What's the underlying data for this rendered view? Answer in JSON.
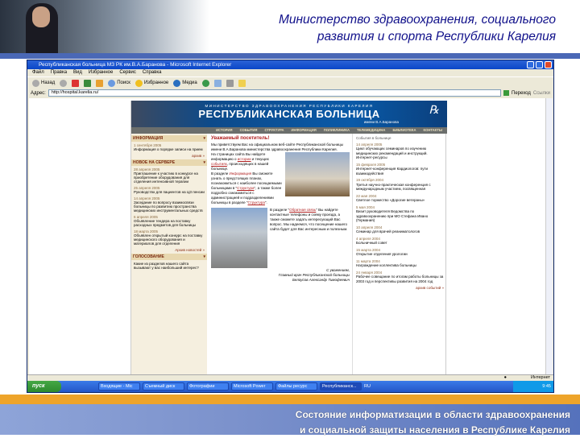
{
  "slide": {
    "title_line1": "Министерство здравоохранения, социального",
    "title_line2": "развития и спорта Республики Карелия",
    "subtitle_line1": "Состояние информатизации в области здравоохранения",
    "subtitle_line2": "и социальной защиты населения в Республике Карелия"
  },
  "browser": {
    "title": "Республиканская больница МЗ РК им.В.А.Баранова - Microsoft Internet Explorer",
    "menu": [
      "Файл",
      "Правка",
      "Вид",
      "Избранное",
      "Сервис",
      "Справка"
    ],
    "toolbar": {
      "back": "Назад",
      "search": "Поиск",
      "favorites": "Избранное",
      "media": "Медиа"
    },
    "address_label": "Адрес:",
    "address": "http://hospital.karelia.ru/",
    "go": "Переход",
    "links": "Ссылки",
    "status": "Интернет"
  },
  "taskbar": {
    "start": "пуск",
    "tasks": [
      "Входящие - Mic",
      "Съемный диск",
      "Фотографии",
      "Microsoft Power",
      "Файлы ресурс",
      "Республиканск..."
    ],
    "lang": "RU",
    "clock": "9:45"
  },
  "site": {
    "banner_ministry": "МИНИСТЕРСТВО ЗДРАВООХРАНЕНИЯ РЕСПУБЛИКИ КАРЕЛИЯ",
    "banner_name": "РЕСПУБЛИКАНСКАЯ БОЛЬНИЦА",
    "banner_sub": "имени В.А.Баранова",
    "logo": "РБ",
    "nav": [
      "ИСТОРИЯ",
      "СОБЫТИЯ",
      "СТРУКТУРА",
      "ИНФОРМАЦИЯ",
      "ПОЛИКЛИНИКА",
      "ТЕЛЕМЕДИЦИНА",
      "БИБЛИОТЕКА",
      "КОНТАКТЫ"
    ],
    "left": {
      "info_header": "ИНФОРМАЦИЯ",
      "info_items": [
        {
          "date": "1 сентября 2005",
          "text": "Информация о порядке записи на прием"
        }
      ],
      "info_archive": "архив »",
      "news_header": "НОВОЕ НА СЕРВЕРЕ",
      "news": [
        {
          "date": "28 апреля 2005",
          "text": "Приглашение к участию в конкурсе на приобретение оборудования для отделения интенсивной терапии"
        },
        {
          "date": "25 апреля 2005",
          "text": "Руководство для пациентов на ЦЗ пенсии"
        },
        {
          "date": "14 апреля 2005",
          "text": "Заседание по вопросу взаимосвязи больницы по развитию пространства медицинских инструментальных средств"
        },
        {
          "date": "6 апреля 2005",
          "text": "Объявление тендера на поставку расходных предметов для больницы"
        },
        {
          "date": "18 марта 2005",
          "text": "Объявлен открытый конкурс на поставку медицинского оборудования и материалов для отделения"
        }
      ],
      "news_archive": "Архив новостей »",
      "poll_header": "ГОЛОСОВАНИЕ",
      "poll_text": "Какие из разделов нашего сайта вызывают у вас наибольший интерес?"
    },
    "center": {
      "heading": "Уважаемый посетитель!",
      "p1": "Мы приветствуем Вас на официальном веб-сайте Республиканской больницы имени В.А.Баранова министерства здравоохранения Республики Карелия.",
      "p2a": "На страницах сайта Вы найдете информацию о ",
      "link_history": "истории",
      "p2b": " и текущих ",
      "link_events": "событиях",
      "p2c": ", происходящих в нашей больнице.",
      "p3a": "В разделе ",
      "link_info": "Информация",
      "p3b": " Вы сможете узнать о предстоящих планах, познакомиться с наиболее посещаемыми больницами в \"",
      "link_structure": "Структура",
      "p3c": "\", а также более подробно ознакомиться с администрацией и подразделениями больницы в разделе \"",
      "link_struct2": "Структура",
      "p3d": "\".",
      "p4a": "В разделе \"",
      "link_contacts": "Обратная связь",
      "p4b": "\" Вы найдете контактные телефоны и схему проезда, а также сможете задать интересующий Вас вопрос. Мы надеемся, что посещение нашего сайта будет для Вас интересным и полезным.",
      "sign1": "С уважением,",
      "sign2": "Главный врач Республиканской больницы",
      "sign3": "Белоусов Александр Тимофеевич"
    },
    "right": {
      "header": "События в больнице",
      "events": [
        {
          "date": "14 апреля 2005",
          "text": "Цикл обучающих семинаров по изучению медицинских рекомендаций и инструкций. Интернет-ресурсы"
        },
        {
          "date": "15 февраля 2005",
          "text": "Интернет-конференция Кардиологов: пути взаимодействия"
        },
        {
          "date": "19 октября 2004",
          "text": "Третья научно-практическая конференция с международным участием, посвященная"
        },
        {
          "date": "22 мая 2004",
          "text": "Светлое торжество «Дорогие ветераны»"
        },
        {
          "date": "5 мая 2004",
          "text": "Визит руководителя Ведомства по здравоохранению при МО Стефана Ивано (Германия)"
        },
        {
          "date": "10 апреля 2004",
          "text": "Семинар для врачей реаниматологов"
        },
        {
          "date": "4 апреля 2004",
          "text": "Больничный совет"
        },
        {
          "date": "15 марта 2004",
          "text": "Открытие отделения урологии"
        },
        {
          "date": "11 марта 2004",
          "text": "Награждение коллектива больницы"
        },
        {
          "date": "24 января 2004",
          "text": "Рабочее совещание по итогам работы больницы за 2003 год и перспективы развития на 2004 год"
        }
      ],
      "archive": "архив событий »"
    }
  }
}
